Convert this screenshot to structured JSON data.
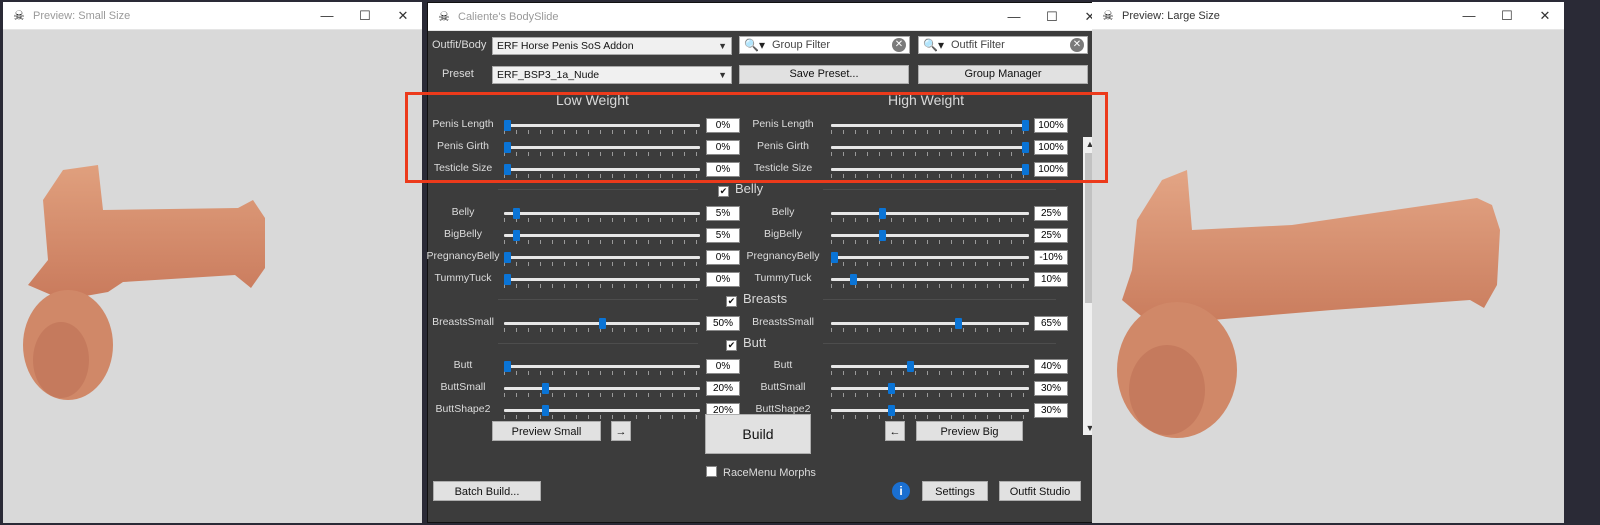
{
  "small_preview": {
    "title": "Preview: Small Size"
  },
  "large_preview": {
    "title": "Preview: Large Size"
  },
  "main": {
    "title": "Caliente's BodySlide",
    "outfit_label": "Outfit/Body",
    "outfit_value": "ERF Horse Penis SoS Addon",
    "preset_label": "Preset",
    "preset_value": "ERF_BSP3_1a_Nude",
    "group_filter": "Group Filter",
    "outfit_filter": "Outfit Filter",
    "save_preset": "Save Preset...",
    "group_manager": "Group Manager",
    "low_weight": "Low Weight",
    "high_weight": "High Weight",
    "groups": {
      "belly": "Belly",
      "breasts": "Breasts",
      "butt": "Butt"
    },
    "sliders": [
      {
        "name": "Penis Length",
        "low": 0,
        "high": 100,
        "low_text": "0%",
        "high_text": "100%"
      },
      {
        "name": "Penis Girth",
        "low": 0,
        "high": 100,
        "low_text": "0%",
        "high_text": "100%"
      },
      {
        "name": "Testicle Size",
        "low": 0,
        "high": 100,
        "low_text": "0%",
        "high_text": "100%"
      },
      {
        "name": "Belly",
        "low": 5,
        "high": 25,
        "low_text": "5%",
        "high_text": "25%"
      },
      {
        "name": "BigBelly",
        "low": 5,
        "high": 25,
        "low_text": "5%",
        "high_text": "25%"
      },
      {
        "name": "PregnancyBelly",
        "low": 0,
        "high": -10,
        "low_text": "0%",
        "high_text": "-10%"
      },
      {
        "name": "TummyTuck",
        "low": 0,
        "high": 10,
        "low_text": "0%",
        "high_text": "10%"
      },
      {
        "name": "BreastsSmall",
        "low": 50,
        "high": 65,
        "low_text": "50%",
        "high_text": "65%"
      },
      {
        "name": "Butt",
        "low": 0,
        "high": 40,
        "low_text": "0%",
        "high_text": "40%"
      },
      {
        "name": "ButtSmall",
        "low": 20,
        "high": 30,
        "low_text": "20%",
        "high_text": "30%"
      },
      {
        "name": "ButtShape2",
        "low": 20,
        "high": 30,
        "low_text": "20%",
        "high_text": "30%"
      }
    ],
    "preview_small": "Preview Small",
    "arrow_right": "→",
    "build": "Build",
    "arrow_left": "←",
    "preview_big": "Preview Big",
    "racemenu": "RaceMenu Morphs",
    "batch_build": "Batch Build...",
    "info": "i",
    "settings": "Settings",
    "outfit_studio": "Outfit Studio"
  },
  "colors": {
    "accent": "#0a74d6",
    "highlight": "#ec3a1b",
    "panel": "#3c3c3c"
  },
  "icons": [
    "app-icon",
    "minimize-icon",
    "maximize-icon",
    "close-icon",
    "search-icon",
    "clear-icon",
    "info-icon",
    "checkbox-checked-icon"
  ]
}
